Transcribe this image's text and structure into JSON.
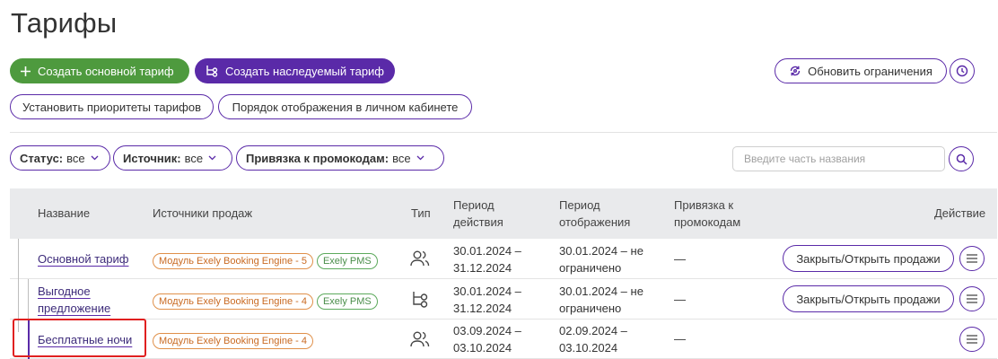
{
  "page": {
    "title": "Тарифы"
  },
  "toolbar": {
    "create_main": "Создать основной тариф",
    "create_inherited": "Создать наследуемый тариф",
    "update_restrictions": "Обновить ограничения",
    "set_priorities": "Установить приоритеты тарифов",
    "display_order": "Порядок отображения в личном кабинете"
  },
  "filters": {
    "status": {
      "label": "Статус:",
      "value": "все"
    },
    "source": {
      "label": "Источник:",
      "value": "все"
    },
    "promo": {
      "label": "Привязка к промокодам:",
      "value": "все"
    },
    "search_placeholder": "Введите часть названия"
  },
  "table": {
    "headers": {
      "name": "Название",
      "sources": "Источники продаж",
      "type": "Тип",
      "period_action_1": "Период",
      "period_action_2": "действия",
      "period_display_1": "Период",
      "period_display_2": "отображения",
      "promo_1": "Привязка к",
      "promo_2": "промокодам",
      "action": "Действие"
    },
    "rows": [
      {
        "name": "Основной тариф",
        "sources": [
          "Модуль Exely Booking Engine - 5",
          "Exely PMS"
        ],
        "type_icon": "users-icon",
        "period_action": [
          "30.01.2024 –",
          "31.12.2024"
        ],
        "period_display": [
          "30.01.2024 – не",
          "ограничено"
        ],
        "promo": "—",
        "action": "Закрыть/Открыть продажи"
      },
      {
        "name_1": "Выгодное",
        "name_2": "предложение",
        "sources": [
          "Модуль Exely Booking Engine - 4",
          "Exely PMS"
        ],
        "type_icon": "inherit-icon",
        "period_action": [
          "30.01.2024 –",
          "31.12.2024"
        ],
        "period_display": [
          "30.01.2024 – не",
          "ограничено"
        ],
        "promo": "—",
        "action": "Закрыть/Открыть продажи"
      },
      {
        "name": "Бесплатные ночи",
        "sources": [
          "Модуль Exely Booking Engine - 4"
        ],
        "type_icon": "users-icon",
        "period_action": [
          "03.09.2024 –",
          "03.10.2024"
        ],
        "period_display": [
          "02.09.2024 –",
          "03.10.2024"
        ],
        "promo": "—"
      }
    ]
  },
  "colors": {
    "accent": "#5a2aa8",
    "green": "#4e9a3e",
    "highlight": "#e02020"
  }
}
